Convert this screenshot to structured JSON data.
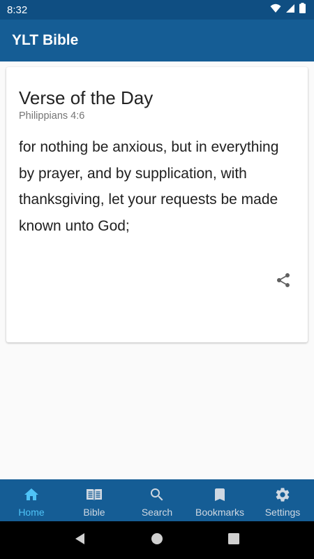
{
  "status_bar": {
    "time": "8:32"
  },
  "app_bar": {
    "title": "YLT Bible"
  },
  "verse_card": {
    "heading": "Verse of the Day",
    "reference": "Philippians 4:6",
    "text": "for nothing be anxious, but in everything by prayer, and by supplication, with thanksgiving, let your requests be made known unto God;"
  },
  "bottom_nav": {
    "items": [
      {
        "label": "Home",
        "icon": "home-icon",
        "active": true
      },
      {
        "label": "Bible",
        "icon": "book-icon",
        "active": false
      },
      {
        "label": "Search",
        "icon": "search-icon",
        "active": false
      },
      {
        "label": "Bookmarks",
        "icon": "bookmark-icon",
        "active": false
      },
      {
        "label": "Settings",
        "icon": "gear-icon",
        "active": false
      }
    ]
  },
  "colors": {
    "primary": "#155d95",
    "status_bar": "#0f4e82",
    "active_tab": "#4fc3f7",
    "inactive_tab": "#cfd8e2"
  }
}
